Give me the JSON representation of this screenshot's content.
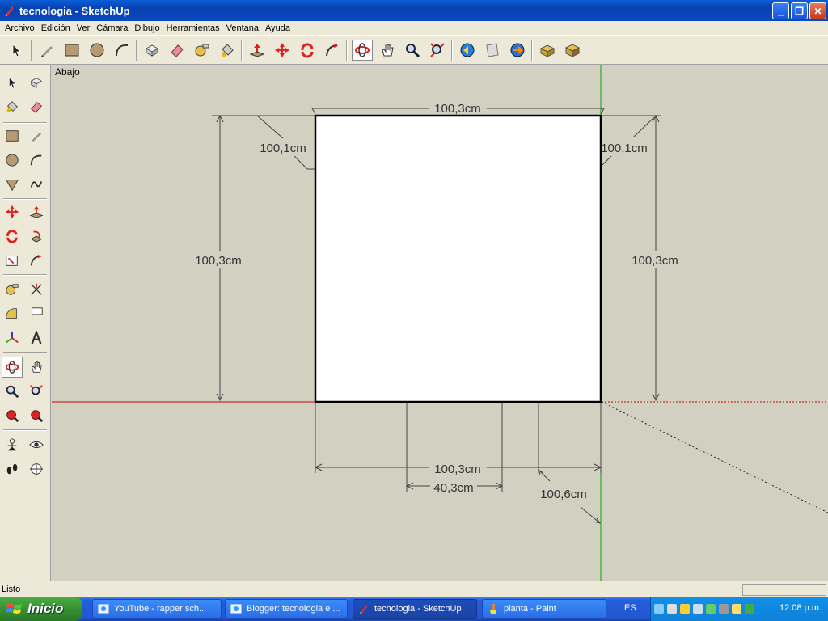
{
  "window": {
    "title": "tecnologia - SketchUp"
  },
  "menubar": {
    "items": [
      "Archivo",
      "Edición",
      "Ver",
      "Cámara",
      "Dibujo",
      "Herramientas",
      "Ventana",
      "Ayuda"
    ]
  },
  "toolbar": {
    "tools": [
      "select-icon",
      "pencil-icon",
      "rectangle-icon",
      "circle-icon",
      "arc-icon",
      "make-component-icon",
      "eraser-icon",
      "tape-measure-icon",
      "paint-bucket-icon",
      "push-pull-icon",
      "move-icon",
      "rotate-icon",
      "follow-me-icon",
      "orbit-icon",
      "pan-icon",
      "zoom-icon",
      "zoom-extents-icon",
      "previous-view-icon",
      "next-view-icon",
      "get-models-icon",
      "share-model-icon",
      "component-icon",
      "dynamic-component-icon"
    ],
    "active_tool": "orbit-icon"
  },
  "viewport": {
    "scene_label": "Abajo",
    "dimensions": {
      "top_width": "100,3cm",
      "top_left_diag": "100,1cm",
      "top_right_diag": "100,1cm",
      "left_height": "100,3cm",
      "right_height": "100,3cm",
      "bottom_width": "100,3cm",
      "bottom_inner": "40,3cm",
      "bottom_diag": "100,6cm"
    },
    "colors": {
      "background": "#d2d0c0",
      "face": "#ffffff",
      "red_axis": "#cc0000",
      "green_axis": "#00aa00"
    }
  },
  "statusbar": {
    "text": "Listo"
  },
  "taskbar": {
    "start_label": "Inicio",
    "tasks": [
      {
        "label": "YouTube - rapper sch...",
        "active": false
      },
      {
        "label": "Blogger: tecnologia e ...",
        "active": false
      },
      {
        "label": "tecnologia - SketchUp",
        "active": true
      },
      {
        "label": "planta - Paint",
        "active": false
      }
    ],
    "language": "ES",
    "clock": "12:08 p.m."
  }
}
